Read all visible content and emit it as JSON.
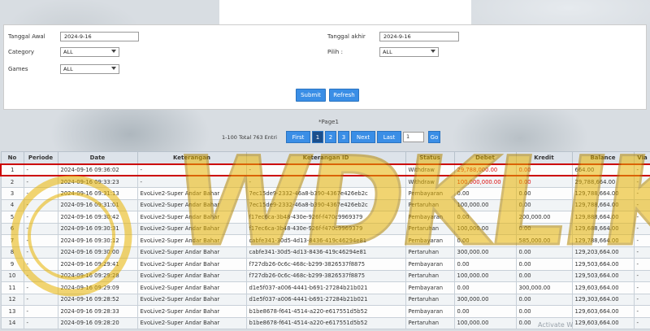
{
  "filters": {
    "tanggal_awal_label": "Tanggal Awal",
    "tanggal_awal_value": "2024-9-16",
    "tanggal_akhir_label": "Tanggal akhir",
    "tanggal_akhir_value": "2024-9-16",
    "category_label": "Category",
    "category_value": "ALL",
    "pilih_label": "Pilih  :",
    "pilih_value": "ALL",
    "games_label": "Games",
    "games_value": "ALL",
    "submit_label": "Submit",
    "refresh_label": "Refresh"
  },
  "pager": {
    "title": "*Page1",
    "total_text": "1-100 Total 763 Entri",
    "first": "First",
    "page1": "1",
    "page2": "2",
    "page3": "3",
    "next": "Next",
    "last": "Last",
    "page_input": "1",
    "go": "Go"
  },
  "table": {
    "headers": [
      "No",
      "Periode",
      "Date",
      "Keterangan",
      "Keterangan ID",
      "Status",
      "Debet",
      "Kredit",
      "Balance",
      "Via"
    ],
    "rows": [
      [
        "1",
        "-",
        "2024-09-16 09:36:02",
        "-",
        "-",
        "Withdraw",
        "29,788,000.00",
        "0.00",
        "664.00",
        "-"
      ],
      [
        "2",
        "-",
        "2024-09-16 09:33:23",
        "-",
        "-",
        "Withdraw",
        "100,000,000.00",
        "0.00",
        "29,788,664.00",
        "-"
      ],
      [
        "3",
        "-",
        "2024-09-16 09:31:13",
        "EvoLive2-Super Andar Bahar",
        "7ec15de9-2332-46a8-b390-4367e426eb2c",
        "Pembayaran",
        "0.00",
        "0.00",
        "129,788,664.00",
        "-"
      ],
      [
        "4",
        "-",
        "2024-09-16 09:31:01",
        "EvoLive2-Super Andar Bahar",
        "7ec15de9-2332-46a8-b390-4367e426eb2c",
        "Pertaruhan",
        "100,000.00",
        "0.00",
        "129,788,664.00",
        "-"
      ],
      [
        "5",
        "-",
        "2024-09-16 09:30:42",
        "EvoLive2-Super Andar Bahar",
        "f17ec6ca-3b48-430e-926f-f470c9969379",
        "Pembayaran",
        "0.00",
        "200,000.00",
        "129,888,664.00",
        "-"
      ],
      [
        "6",
        "-",
        "2024-09-16 09:30:31",
        "EvoLive2-Super Andar Bahar",
        "f17ec6ca-3b48-430e-926f-f470c9969379",
        "Pertaruhan",
        "100,000.00",
        "0.00",
        "129,688,664.00",
        "-"
      ],
      [
        "7",
        "-",
        "2024-09-16 09:30:12",
        "EvoLive2-Super Andar Bahar",
        "cabfe341-30d5-4d13-8436-419c46294e81",
        "Pembayaran",
        "0.00",
        "585,000.00",
        "129,788,664.00",
        "-"
      ],
      [
        "8",
        "-",
        "2024-09-16 09:30:00",
        "EvoLive2-Super Andar Bahar",
        "cabfe341-30d5-4d13-8436-419c46294e81",
        "Pertaruhan",
        "300,000.00",
        "0.00",
        "129,203,664.00",
        "-"
      ],
      [
        "9",
        "-",
        "2024-09-16 09:29:41",
        "EvoLive2-Super Andar Bahar",
        "f727db26-0c6c-468c-b299-3826537f8875",
        "Pembayaran",
        "0.00",
        "0.00",
        "129,503,664.00",
        "-"
      ],
      [
        "10",
        "-",
        "2024-09-16 09:29:28",
        "EvoLive2-Super Andar Bahar",
        "f727db26-0c6c-468c-b299-3826537f8875",
        "Pertaruhan",
        "100,000.00",
        "0.00",
        "129,503,664.00",
        "-"
      ],
      [
        "11",
        "-",
        "2024-09-16 09:29:09",
        "EvoLive2-Super Andar Bahar",
        "d1e5f037-a006-4441-b691-27284b21b021",
        "Pembayaran",
        "0.00",
        "300,000.00",
        "129,603,664.00",
        "-"
      ],
      [
        "12",
        "-",
        "2024-09-16 09:28:52",
        "EvoLive2-Super Andar Bahar",
        "d1e5f037-a006-4441-b691-27284b21b021",
        "Pertaruhan",
        "300,000.00",
        "0.00",
        "129,303,664.00",
        "-"
      ],
      [
        "13",
        "-",
        "2024-09-16 09:28:33",
        "EvoLive2-Super Andar Bahar",
        "b1be8678-f641-4514-a220-e617551d5b52",
        "Pembayaran",
        "0.00",
        "0.00",
        "129,603,664.00",
        "-"
      ],
      [
        "14",
        "-",
        "2024-09-16 09:28:20",
        "EvoLive2-Super Andar Bahar",
        "b1be8678-f641-4514-a220-e617551d5b52",
        "Pertaruhan",
        "100,000.00",
        "0.00",
        "129,603,664.00",
        "-"
      ]
    ]
  },
  "watermark": {
    "text": "WDKLIK",
    "color": "#e8b400"
  },
  "activate_text": "Activate W",
  "colors": {
    "button": "#3a8ee6",
    "highlight": "#cc0000",
    "debit_red": "#dd1111"
  }
}
